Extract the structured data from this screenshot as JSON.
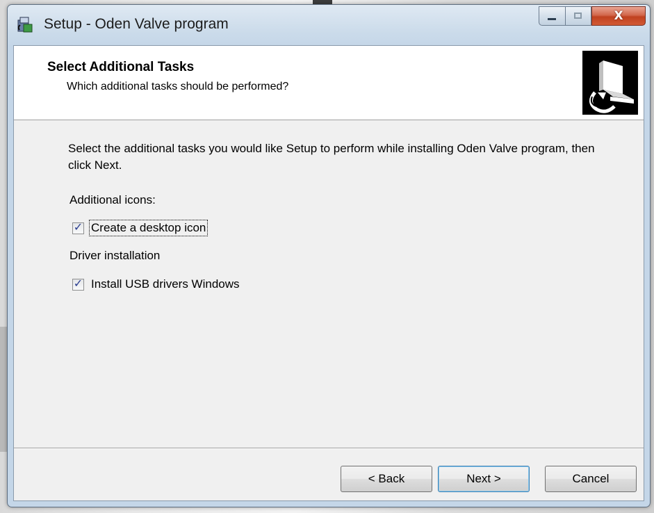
{
  "window": {
    "title": "Setup - Oden Valve program",
    "controls": {
      "minimize": "minimize-icon",
      "maximize": "maximize-icon",
      "close_glyph": "X"
    }
  },
  "header": {
    "title": "Select Additional Tasks",
    "subtitle": "Which additional tasks should be performed?",
    "image_icon": "setup-computer-icon"
  },
  "body": {
    "instructions": "Select the additional tasks you would like Setup to perform while installing Oden Valve program, then click Next.",
    "groups": [
      {
        "label": "Additional icons:",
        "tasks": [
          {
            "label": "Create a desktop icon",
            "checked": true,
            "focused": true
          }
        ]
      },
      {
        "label": "Driver installation",
        "tasks": [
          {
            "label": "Install USB drivers Windows",
            "checked": true,
            "focused": false
          }
        ]
      }
    ]
  },
  "buttons": {
    "back": "< Back",
    "next": "Next >",
    "cancel": "Cancel"
  },
  "colors": {
    "default_button_border": "#3c7fb1",
    "close_button": "#c0411f",
    "checkmark": "#2a3d8f"
  }
}
